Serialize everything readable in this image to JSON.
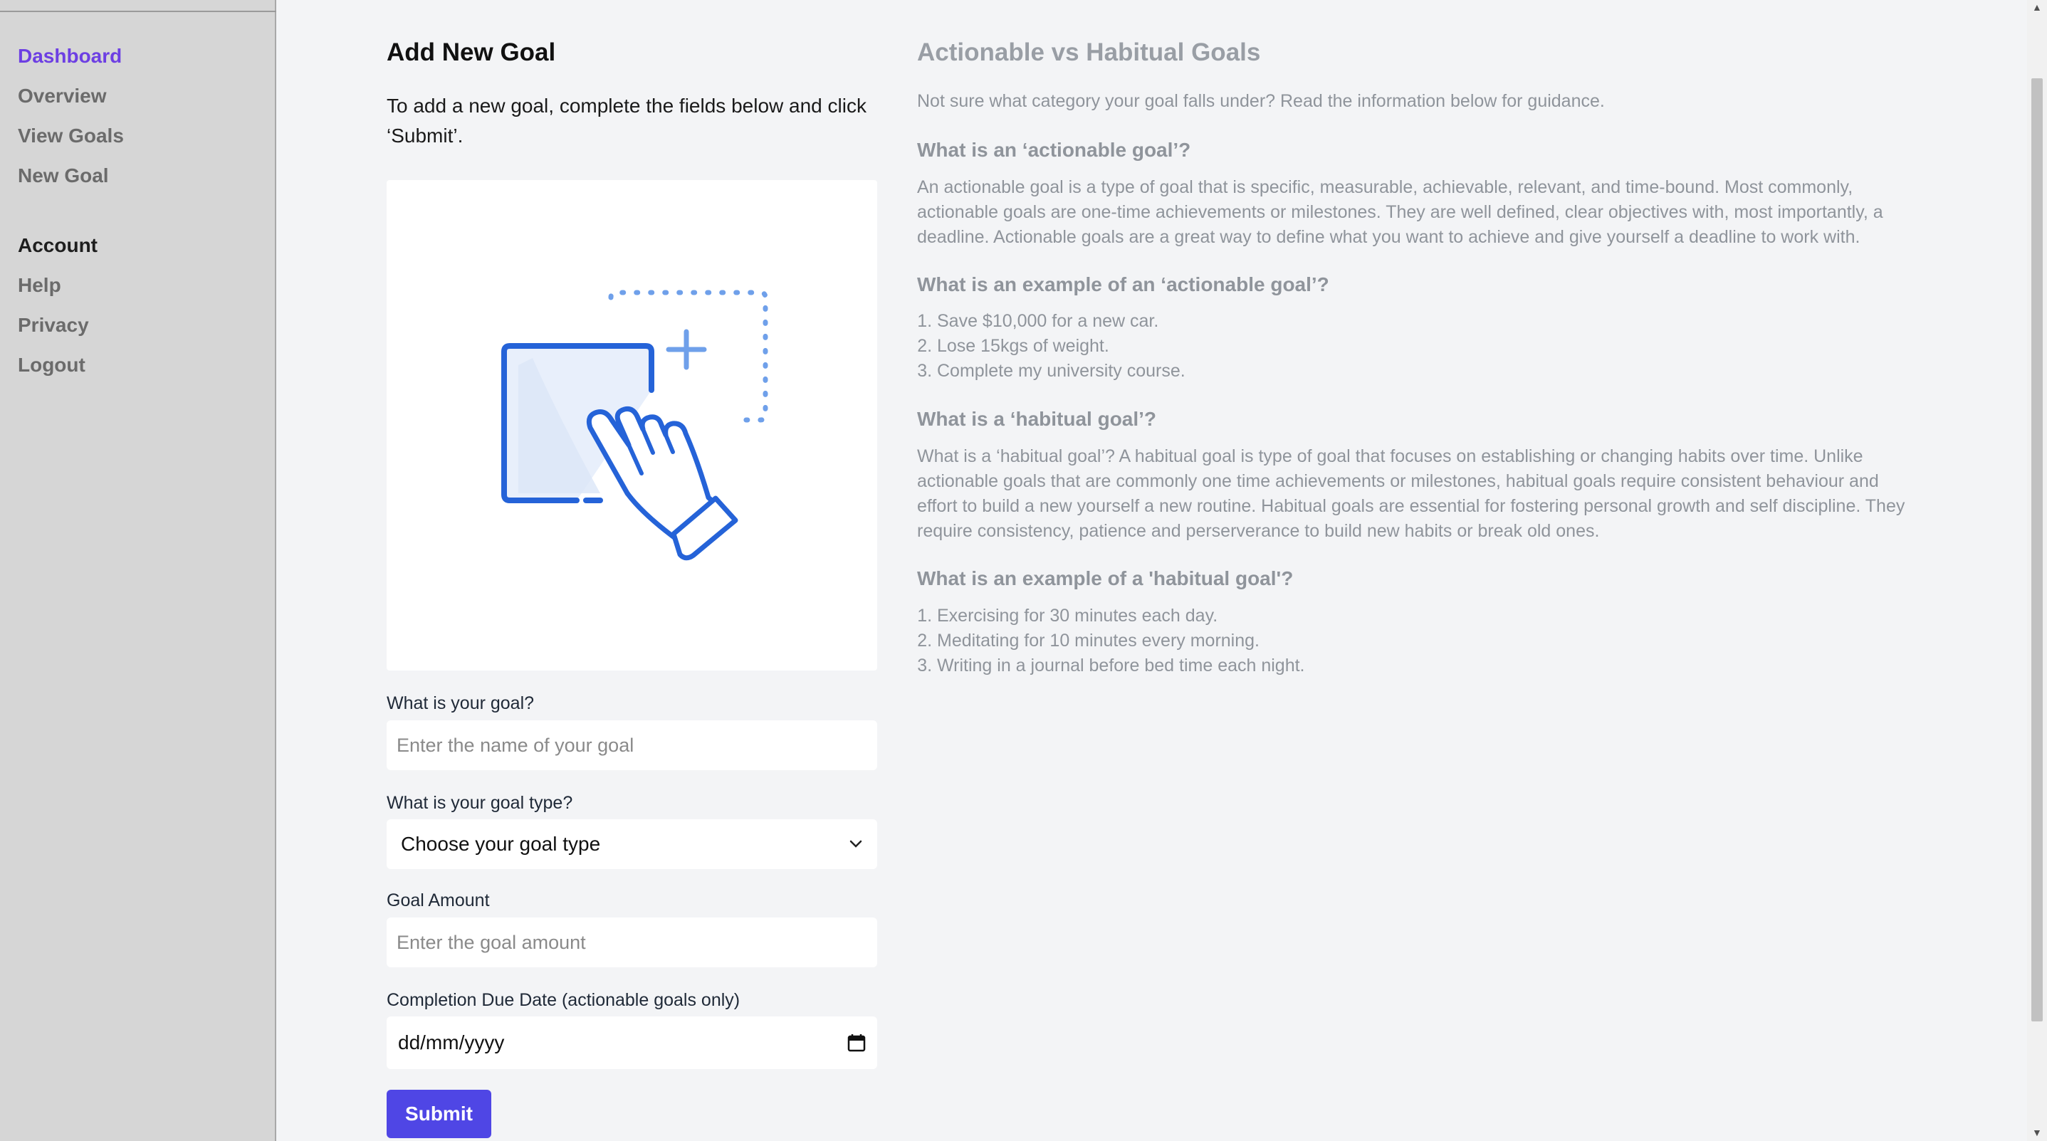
{
  "sidebar": {
    "items": [
      {
        "label": "Dashboard"
      },
      {
        "label": "Overview"
      },
      {
        "label": "View Goals"
      },
      {
        "label": "New Goal"
      },
      {
        "label": "Account"
      },
      {
        "label": "Help"
      },
      {
        "label": "Privacy"
      },
      {
        "label": "Logout"
      }
    ]
  },
  "form": {
    "title": "Add New Goal",
    "intro": "To add a new goal, complete the fields below and click ‘Submit’.",
    "goal_label": "What is your goal?",
    "goal_placeholder": "Enter the name of your goal",
    "type_label": "What is your goal type?",
    "type_selected": "Choose your goal type",
    "amount_label": "Goal Amount",
    "amount_placeholder": "Enter the goal amount",
    "date_label": "Completion Due Date (actionable goals only)",
    "date_value": "dd/mm/yyyy",
    "submit_label": "Submit"
  },
  "info": {
    "title": "Actionable vs Habitual Goals",
    "lead": "Not sure what category your goal falls under? Read the information below for guidance.",
    "actionable_heading": "What is an ‘actionable goal’?",
    "actionable_body": "An actionable goal is a type of goal that is specific, measurable, achievable, relevant, and time-bound. Most commonly, actionable goals are one-time achievements or milestones. They are well defined, clear objectives with, most importantly, a deadline. Actionable goals are a great way to define what you want to achieve and give yourself a deadline to work with.",
    "actionable_example_heading": "What is an example of an ‘actionable goal’?",
    "actionable_examples": [
      "Save $10,000 for a new car.",
      "Lose 15kgs of weight.",
      "Complete my university course."
    ],
    "habitual_heading": "What is a ‘habitual goal’?",
    "habitual_body": "What is a ‘habitual goal’? A habitual goal is type of goal that focuses on establishing or changing habits over time. Unlike actionable goals that are commonly one time achievements or milestones, habitual goals require consistent behaviour and effort to build a new yourself a new routine. Habitual goals are essential for fostering personal growth and self discipline. They require consistency, patience and perserverance to build new habits or break old ones.",
    "habitual_example_heading": "What is an example of a 'habitual goal'?",
    "habitual_examples": [
      "Exercising for 30 minutes each day.",
      "Meditating for 10 minutes every morning.",
      "Writing in a journal before bed time each night."
    ]
  },
  "colors": {
    "accent": "#6d3fe3",
    "submit": "#4f46e5",
    "illustration": "#2563d8"
  }
}
